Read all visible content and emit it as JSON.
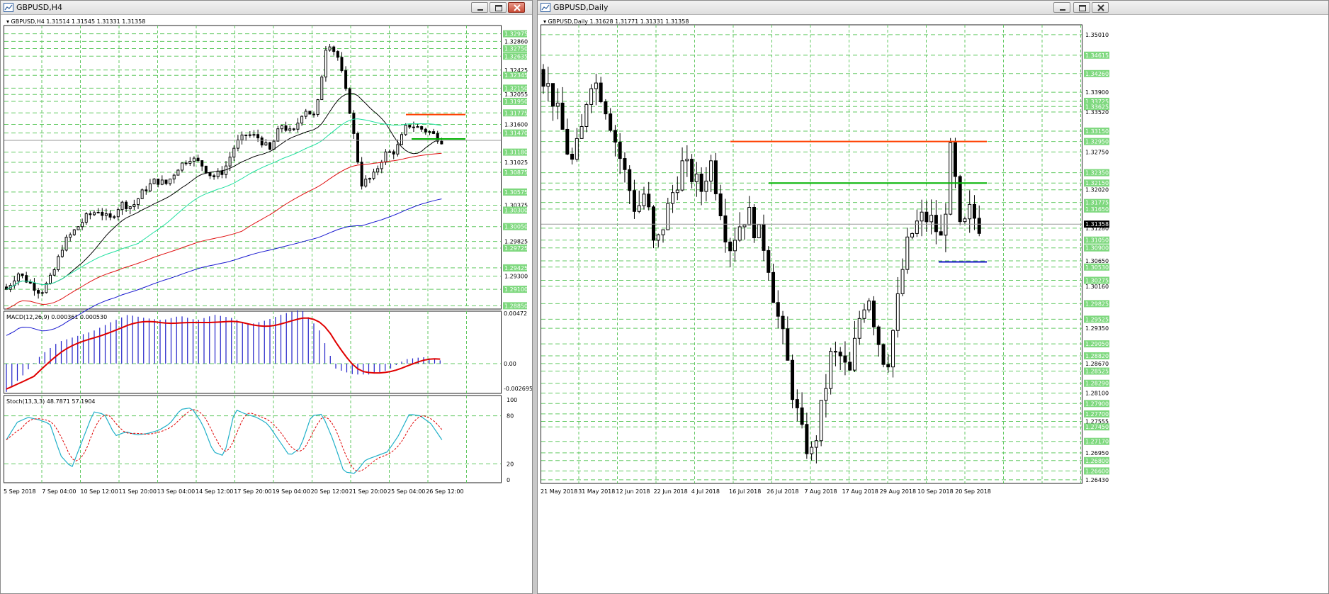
{
  "left_window": {
    "title": "GBPUSD,H4",
    "header": "GBPUSD,H4  1.31514 1.31545 1.31331 1.31358",
    "macd_label": "MACD(12,26,9) 0.000361 0.000530",
    "stoch_label": "Stoch(13,3,3) 48.7871 57.1904",
    "price_axis": [
      "1.32975",
      "1.32860",
      "1.32750",
      "1.32635",
      "1.32425",
      "1.32345",
      "1.32150",
      "1.32055",
      "1.31950",
      "1.31775",
      "1.31600",
      "1.31470",
      "1.31180",
      "1.31025",
      "1.30875",
      "1.30575",
      "1.30375",
      "1.30300",
      "1.30050",
      "1.29825",
      "1.29725",
      "1.29425",
      "1.29300",
      "1.29100",
      "1.28850"
    ],
    "macd_axis": [
      "0.00472",
      "0.00",
      "-0.002695"
    ],
    "stoch_axis": [
      "100",
      "80",
      "20",
      "0"
    ],
    "time_axis": [
      "5 Sep 2018",
      "7 Sep 04:00",
      "10 Sep 12:00",
      "11 Sep 20:00",
      "13 Sep 04:00",
      "14 Sep 12:00",
      "17 Sep 20:00",
      "19 Sep 04:00",
      "20 Sep 12:00",
      "21 Sep 20:00",
      "25 Sep 04:00",
      "26 Sep 12:00"
    ]
  },
  "right_window": {
    "title": "GBPUSD,Daily",
    "header": "GBPUSD,Daily  1.31628 1.31771 1.31331 1.31358",
    "price_axis": [
      "1.35010",
      "1.34615",
      "1.34260",
      "1.33900",
      "1.33725",
      "1.33625",
      "1.33520",
      "1.33150",
      "1.32950",
      "1.32750",
      "1.32350",
      "1.32150",
      "1.32020",
      "1.31775",
      "1.31650",
      "1.31280",
      "1.31050",
      "1.30900",
      "1.30650",
      "1.30530",
      "1.30275",
      "1.30160",
      "1.29825",
      "1.29525",
      "1.29350",
      "1.29050",
      "1.28820",
      "1.28670",
      "1.28525",
      "1.28290",
      "1.28100",
      "1.27900",
      "1.27700",
      "1.27555",
      "1.27450",
      "1.27170",
      "1.26950",
      "1.26800",
      "1.26600",
      "1.26430"
    ],
    "current_price": "1.31358",
    "time_axis": [
      "21 May 2018",
      "31 May 2018",
      "12 Jun 2018",
      "22 Jun 2018",
      "4 Jul 2018",
      "16 Jul 2018",
      "26 Jul 2018",
      "7 Aug 2018",
      "17 Aug 2018",
      "29 Aug 2018",
      "10 Sep 2018",
      "20 Sep 2018"
    ]
  },
  "colors": {
    "grid": "#63c963",
    "bull": "#ffffff",
    "bear": "#000000",
    "resistance": "#ff4000",
    "support": "#00b400",
    "blue_line": "#1414c8",
    "ma_red": "#e01010",
    "ma_teal": "#20e0a0",
    "ma_black": "#000000",
    "ma_blue": "#1818d0",
    "macd_hist": "#2020c8",
    "macd_signal": "#e00000",
    "stoch_main": "#20b0c8",
    "stoch_signal": "#e00000"
  }
}
